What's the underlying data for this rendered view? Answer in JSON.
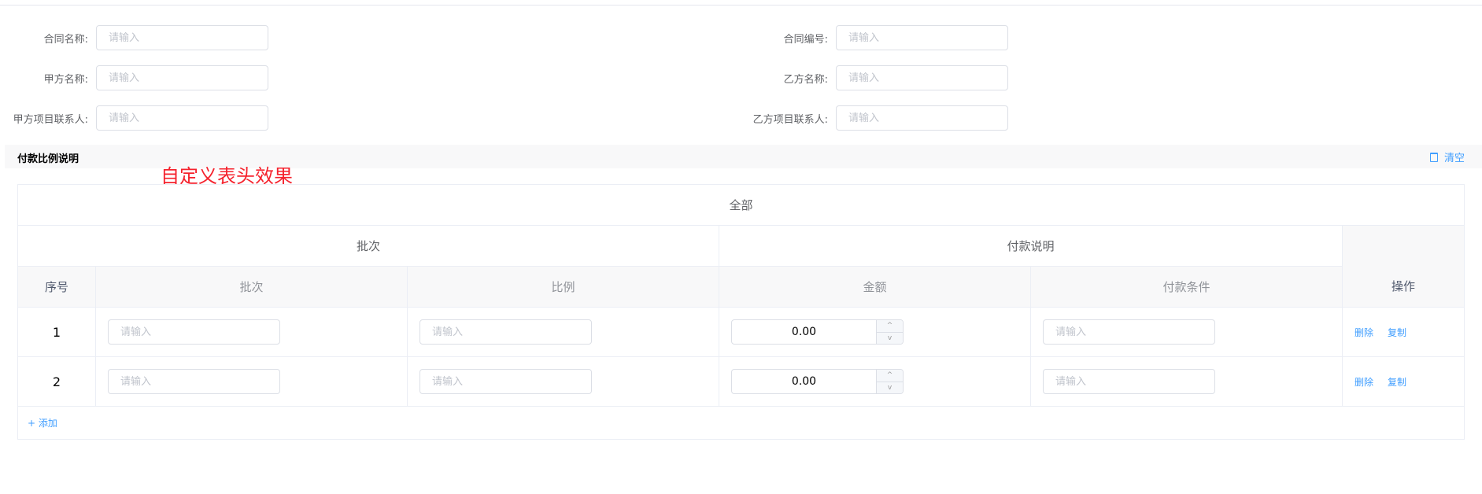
{
  "form": {
    "placeholder": "请输入",
    "left": [
      "合同名称:",
      "甲方名称:",
      "甲方项目联系人:"
    ],
    "right": [
      "合同编号:",
      "乙方名称:",
      "乙方项目联系人:"
    ]
  },
  "section": {
    "title": "付款比例说明",
    "clear_label": "清空",
    "annotation": "自定义表头效果"
  },
  "table": {
    "group_all": "全部",
    "group_batch": "批次",
    "group_payment": "付款说明",
    "columns": [
      "序号",
      "批次",
      "比例",
      "金额",
      "付款条件",
      "操作"
    ],
    "rows": [
      {
        "index": "1",
        "amount": "0.00"
      },
      {
        "index": "2",
        "amount": "0.00"
      }
    ],
    "actions": {
      "delete": "删除",
      "copy": "复制"
    },
    "add_label": "添加",
    "input_placeholder": "请输入"
  },
  "colors": {
    "accent": "#409eff",
    "annotation": "#f5222d"
  }
}
